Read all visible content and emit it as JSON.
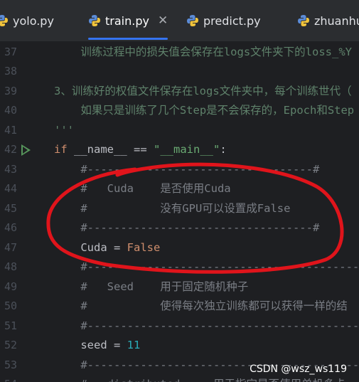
{
  "tabs": [
    {
      "label": "yolo.py",
      "active": false,
      "closable": false
    },
    {
      "label": "train.py",
      "active": true,
      "closable": true
    },
    {
      "label": "predict.py",
      "active": false,
      "closable": false
    },
    {
      "label": "zhuanhu",
      "active": false,
      "closable": false
    }
  ],
  "close_glyph": "✕",
  "lines": [
    {
      "n": "37",
      "text": "    训练过程中的损失值会保存在logs文件夹下的loss_%Y",
      "style": "str-comment"
    },
    {
      "n": "38",
      "text": "",
      "style": ""
    },
    {
      "n": "39",
      "text": "3、训练好的权值文件保存在logs文件夹中，每个训练世代（",
      "style": "str-comment"
    },
    {
      "n": "40",
      "text": "    如果只是训练了几个Step是不会保存的，Epoch和Step",
      "style": "str-comment"
    },
    {
      "n": "41",
      "text": "'''",
      "style": "str-comment"
    },
    {
      "n": "42",
      "tokens": [
        {
          "t": "if",
          "c": "kw"
        },
        {
          "t": " __name__ == ",
          "c": ""
        },
        {
          "t": "\"__main__\"",
          "c": "strg"
        },
        {
          "t": ":",
          "c": ""
        }
      ]
    },
    {
      "n": "43",
      "text": "    #----------------------------------#",
      "style": "cmt"
    },
    {
      "n": "44",
      "text": "    #   Cuda    是否使用Cuda",
      "style": "cmt"
    },
    {
      "n": "45",
      "text": "    #           没有GPU可以设置成False",
      "style": "cmt"
    },
    {
      "n": "46",
      "text": "    #----------------------------------#",
      "style": "cmt"
    },
    {
      "n": "47",
      "tokens": [
        {
          "t": "    Cuda = ",
          "c": ""
        },
        {
          "t": "False",
          "c": "kw"
        }
      ]
    },
    {
      "n": "48",
      "text": "    #----------------------------------------------",
      "style": "cmt"
    },
    {
      "n": "49",
      "text": "    #   Seed    用于固定随机种子",
      "style": "cmt"
    },
    {
      "n": "50",
      "text": "    #           使得每次独立训练都可以获得一样的结",
      "style": "cmt"
    },
    {
      "n": "51",
      "text": "    #----------------------------------------------",
      "style": "cmt"
    },
    {
      "n": "52",
      "tokens": [
        {
          "t": "    seed = ",
          "c": ""
        },
        {
          "t": "11",
          "c": "num"
        }
      ]
    },
    {
      "n": "53",
      "text": "    #----------------------------------------------",
      "style": "cmt"
    },
    {
      "n": "54",
      "text": "    #   distributed     用于指定是否使用单机多卡",
      "style": "cmt"
    }
  ],
  "watermark": "CSDN @wsz_ws119",
  "colors": {
    "annotation": "#e0141b",
    "run": "#57965c",
    "active_tab": "#3574f0"
  }
}
